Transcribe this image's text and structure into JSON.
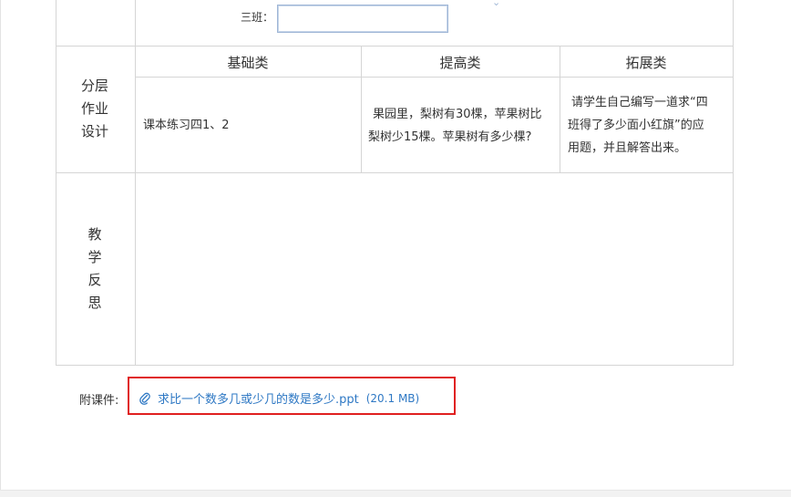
{
  "top_row": {
    "class_label": "三班：",
    "class_value": ""
  },
  "homework": {
    "row_label_lines": [
      "分层",
      "作业",
      "设计"
    ],
    "columns": [
      "基础类",
      "提高类",
      "拓展类"
    ],
    "basic": "课本练习四1、2",
    "advanced_lines": [
      "果园里，梨树有30棵，苹果树比",
      "梨树少15棵。苹果树有多少棵?"
    ],
    "extended_lines": [
      "请学生自己编写一道求“四",
      "班得了多少面小红旗”的应",
      "用题，并且解答出来。"
    ]
  },
  "reflection": {
    "row_label_chars": [
      "教",
      "学",
      "反",
      "思"
    ],
    "content": ""
  },
  "attachment": {
    "label": "附课件:",
    "file_name": "求比一个数多几或少几的数是多少.ppt",
    "file_size": "(20.1 MB)",
    "icon": "paperclip-icon"
  },
  "colors": {
    "link": "#2e78c4",
    "highlight_border": "#e02020",
    "grid": "#d5d5d5"
  }
}
